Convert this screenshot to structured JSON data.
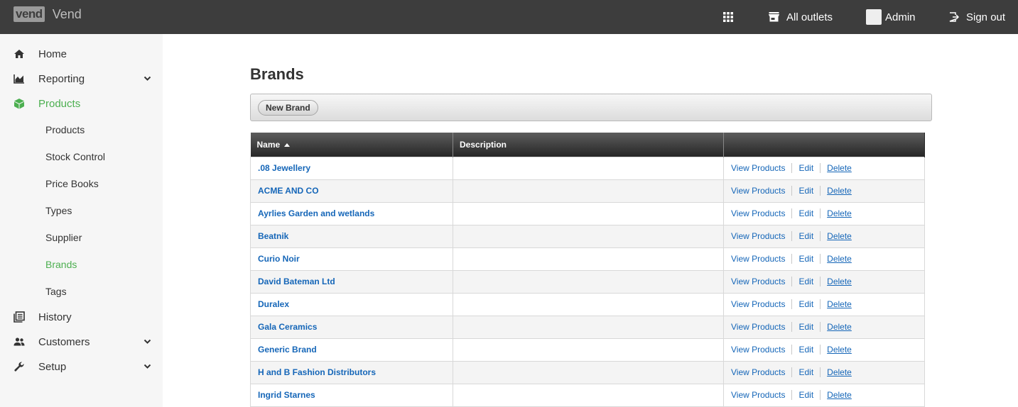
{
  "header": {
    "logo_mark": "vend",
    "app_name": "Vend",
    "apps_icon": "grid-icon",
    "outlets_label": "All outlets",
    "admin_label": "Admin",
    "signout_label": "Sign out"
  },
  "sidebar": {
    "home": "Home",
    "reporting": "Reporting",
    "products": "Products",
    "sub": {
      "products": "Products",
      "stock_control": "Stock Control",
      "price_books": "Price Books",
      "types": "Types",
      "supplier": "Supplier",
      "brands": "Brands",
      "tags": "Tags"
    },
    "history": "History",
    "customers": "Customers",
    "setup": "Setup",
    "accent_color": "#4caf50"
  },
  "page": {
    "title": "Brands",
    "new_button": "New Brand"
  },
  "table": {
    "headers": {
      "name": "Name",
      "description": "Description",
      "actions": ""
    },
    "action_labels": {
      "view": "View Products",
      "edit": "Edit",
      "delete": "Delete"
    },
    "rows": [
      {
        "name": ".08 Jewellery",
        "description": ""
      },
      {
        "name": "ACME AND CO",
        "description": ""
      },
      {
        "name": "Ayrlies Garden and wetlands",
        "description": ""
      },
      {
        "name": "Beatnik",
        "description": ""
      },
      {
        "name": "Curio Noir",
        "description": ""
      },
      {
        "name": "David Bateman Ltd",
        "description": ""
      },
      {
        "name": "Duralex",
        "description": ""
      },
      {
        "name": "Gala Ceramics",
        "description": ""
      },
      {
        "name": "Generic Brand",
        "description": ""
      },
      {
        "name": "H and B Fashion Distributors",
        "description": ""
      },
      {
        "name": "Ingrid Starnes",
        "description": ""
      }
    ]
  }
}
